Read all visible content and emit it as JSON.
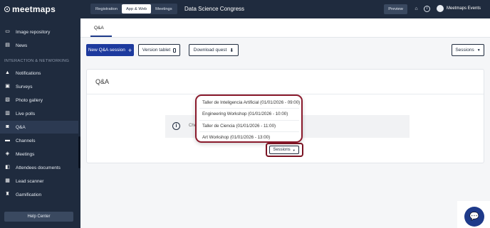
{
  "logo": {
    "text": "meetmaps"
  },
  "sidebar": {
    "top_items": [
      {
        "label": "Image repository",
        "icon": "image-repository-icon"
      },
      {
        "label": "News",
        "icon": "news-icon"
      }
    ],
    "section_label": "INTERACTION & NETWORKING",
    "items": [
      {
        "label": "Notifications",
        "icon": "bell-icon"
      },
      {
        "label": "Surveys",
        "icon": "survey-icon"
      },
      {
        "label": "Photo gallery",
        "icon": "photo-icon"
      },
      {
        "label": "Live polls",
        "icon": "poll-icon"
      },
      {
        "label": "Q&A",
        "icon": "qa-icon"
      },
      {
        "label": "Channels",
        "icon": "channels-icon"
      },
      {
        "label": "Meetings",
        "icon": "handshake-icon"
      },
      {
        "label": "Attendees documents",
        "icon": "documents-icon"
      },
      {
        "label": "Lead scanner",
        "icon": "scanner-icon"
      },
      {
        "label": "Gamification",
        "icon": "trophy-icon"
      }
    ],
    "active_item": "Q&A",
    "help_label": "Help Center"
  },
  "topbar": {
    "tabs": [
      "Registration",
      "App & Web",
      "Meetings"
    ],
    "active_tab": "App & Web",
    "event_title": "Data Science Congress",
    "preview_label": "Preview",
    "user_name": "Meetmaps Events"
  },
  "subnav": {
    "tab_label": "Q&A"
  },
  "actions": {
    "new_session_label": "New Q&A session",
    "version_tablet_label": "Version tablet",
    "download_label": "Download quest",
    "sessions_label": "Sessions"
  },
  "card": {
    "title": "Q&A",
    "info_text": "Che"
  },
  "dropdown": {
    "options": [
      "Taller de Inteligencia Artificial (01/01/2026 - 09:00)",
      "Engineering Workshop (01/01/2026 - 10:00)",
      "Taller de Ciencia (01/01/2026 - 11:00)",
      "Art Workshop (01/01/2026 - 13:00)"
    ],
    "button_label": "Sessions"
  },
  "colors": {
    "sidebar_bg": "#1f2b3e",
    "primary": "#1d3a9e",
    "highlight": "#8a1a2c"
  }
}
